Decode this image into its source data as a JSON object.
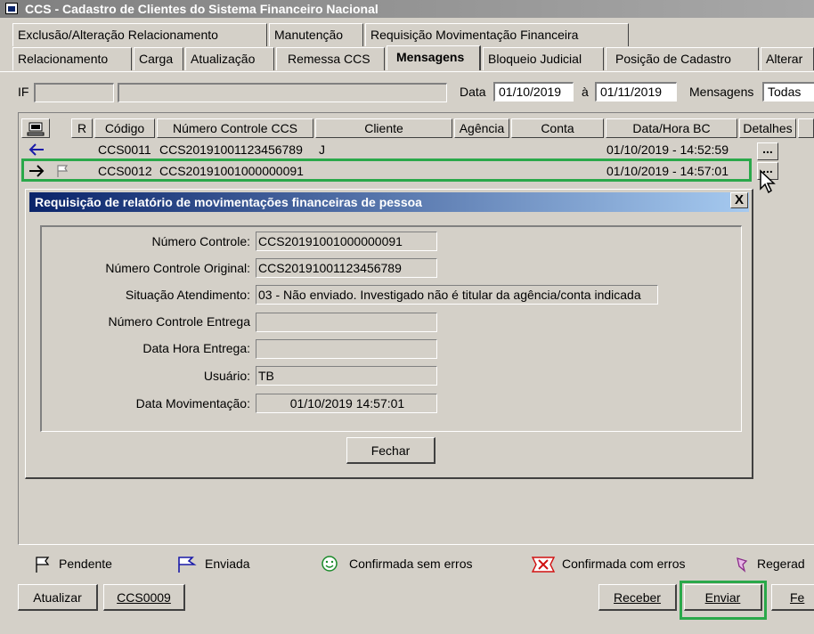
{
  "window": {
    "title": "CCS - Cadastro de Clientes do Sistema Financeiro Nacional"
  },
  "tabs_row1": [
    "Exclusão/Alteração Relacionamento",
    "Manutenção",
    "Requisição Movimentação Financeira"
  ],
  "tabs_row2": [
    "Relacionamento",
    "Carga",
    "Atualização",
    "Remessa CCS",
    "Mensagens",
    "Bloqueio Judicial",
    "Posição de Cadastro",
    "Alterar"
  ],
  "active_tab": "Mensagens",
  "filter": {
    "if_label": "IF",
    "if_code": "",
    "if_name": "",
    "data_label": "Data",
    "date_from": "01/10/2019",
    "a_label": "à",
    "date_to": "01/11/2019",
    "mensagens_label": "Mensagens",
    "mensagens_value": "Todas"
  },
  "grid": {
    "headers": [
      "R",
      "Código",
      "Número Controle CCS",
      "Cliente",
      "Agência",
      "Conta",
      "Data/Hora BC",
      "Detalhes"
    ],
    "rows": [
      {
        "direction": "in",
        "codigo": "CCS0011",
        "numero": "CCS20191001123456789",
        "cliente": "J",
        "agencia": "",
        "conta": "",
        "datahora": "01/10/2019 - 14:52:59",
        "detalhes": "..."
      },
      {
        "direction": "out",
        "codigo": "CCS0012",
        "numero": "CCS20191001000000091",
        "cliente": "",
        "agencia": "",
        "conta": "",
        "datahora": "01/10/2019 - 14:57:01",
        "detalhes": "..."
      }
    ]
  },
  "dialog": {
    "title": "Requisição de relatório de movimentações financeiras de pessoa",
    "close": "X",
    "fields": [
      {
        "label": "Número Controle:",
        "value": "CCS20191001000000091"
      },
      {
        "label": "Número Controle Original:",
        "value": "CCS20191001123456789"
      },
      {
        "label": "Situação Atendimento:",
        "value": "03 - Não enviado. Investigado não é titular da agência/conta indicada"
      },
      {
        "label": "Número Controle Entrega",
        "value": ""
      },
      {
        "label": "Data Hora Entrega:",
        "value": ""
      },
      {
        "label": "Usuário:",
        "value": "TB"
      },
      {
        "label": "Data Movimentação:",
        "value": "01/10/2019 14:57:01"
      }
    ],
    "close_button": "Fechar"
  },
  "legend": [
    "Pendente",
    "Enviada",
    "Confirmada sem erros",
    "Confirmada com erros",
    "Regerad"
  ],
  "buttons": {
    "atualizar": "Atualizar",
    "ccs0009": "CCS0009",
    "receber": "Receber",
    "enviar": "Enviar",
    "fechar_partial": "Fe"
  },
  "colors": {
    "highlight": "#2aa84a",
    "dialog_title": "#0a246a",
    "enviada": "#1a1aa8",
    "sem_erros": "#1a8a2a",
    "com_erros": "#d01010",
    "regerada": "#8a2a8a"
  }
}
